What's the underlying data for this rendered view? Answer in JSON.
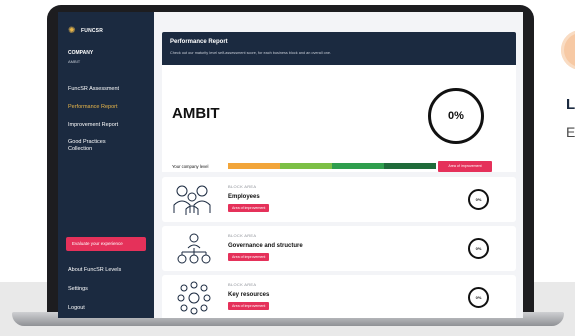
{
  "peek": {
    "title": "L",
    "subtitle": "E"
  },
  "sidebar": {
    "brand": "FUNCSR",
    "company_label": "COMPANY",
    "company_name": "AMBIT",
    "items": [
      {
        "label": "FuncSR Assessment"
      },
      {
        "label": "Performance Report"
      },
      {
        "label": "Improvement Report"
      },
      {
        "label": "Good Practices Collection"
      }
    ],
    "evaluate_label": "Evaluate your experience",
    "bottom": [
      {
        "label": "About FuncSR Levels"
      },
      {
        "label": "Settings"
      },
      {
        "label": "Logout"
      }
    ]
  },
  "header": {
    "title": "Performance Report",
    "subtitle": "Check out our maturity level self-assessment score, for each business block and an overall one."
  },
  "summary": {
    "company": "AMBIT",
    "percent": "0%",
    "level_label": "Your company level",
    "level_colors": [
      "#f2a53a",
      "#7cbf45",
      "#2f9e4d",
      "#1f6b3a"
    ],
    "area_of_improvement": "Area of improvement"
  },
  "blocks": [
    {
      "area": "BLOCK AREA",
      "name": "Employees",
      "tag": "Area of improvement",
      "percent": "0%"
    },
    {
      "area": "BLOCK AREA",
      "name": "Governance and structure",
      "tag": "Area of improvement",
      "percent": "0%"
    },
    {
      "area": "BLOCK AREA",
      "name": "Key resources",
      "tag": "Area of improvement",
      "percent": "0%"
    }
  ],
  "colors": {
    "navy": "#1b2a40",
    "accent": "#e5315a",
    "gold": "#e8b64a"
  },
  "icons": {
    "brand": "sun-logo-icon"
  }
}
